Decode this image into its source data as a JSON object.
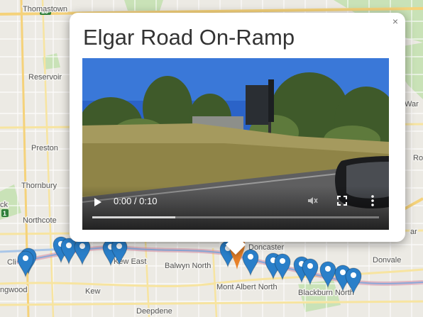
{
  "popup": {
    "title": "Elgar Road On-Ramp",
    "close_label": "×",
    "video": {
      "time": "0:00 / 0:10",
      "buffered_fraction": 0.29
    }
  },
  "map": {
    "suburbs": [
      {
        "id": "thomastown",
        "name": "Thomastown"
      },
      {
        "id": "reservoir",
        "name": "Reservoir"
      },
      {
        "id": "preston",
        "name": "Preston"
      },
      {
        "id": "thornbury",
        "name": "Thornbury"
      },
      {
        "id": "northcote",
        "name": "Northcote"
      },
      {
        "id": "clifton-hill",
        "name": "Cli"
      },
      {
        "id": "collingwood",
        "name": "ngwood"
      },
      {
        "id": "kew",
        "name": "Kew"
      },
      {
        "id": "kew-east",
        "name": "Kew East"
      },
      {
        "id": "balwyn-north",
        "name": "Balwyn North"
      },
      {
        "id": "doncaster",
        "name": "Doncaster"
      },
      {
        "id": "mont-albert-north",
        "name": "Mont Albert North"
      },
      {
        "id": "blackburn-north",
        "name": "Blackburn North"
      },
      {
        "id": "donvale",
        "name": "Donvale"
      },
      {
        "id": "deepdene",
        "name": "Deepdene"
      },
      {
        "id": "ck",
        "name": "ck"
      },
      {
        "id": "ar",
        "name": "ar"
      },
      {
        "id": "war",
        "name": "War"
      },
      {
        "id": "ro",
        "name": "Ro"
      }
    ],
    "shields": [
      "18",
      "1"
    ],
    "colors": {
      "marker_blue": "#2a7fc9",
      "marker_active": "#e8822a",
      "route_outline": "#d98aa2"
    }
  }
}
